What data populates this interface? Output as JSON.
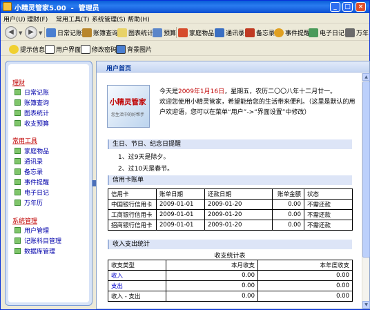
{
  "window": {
    "title": "小精灵管家5.00  -  管理员",
    "min_label": "_",
    "max_label": "□",
    "close_label": "×"
  },
  "menu": [
    "用户(U)",
    "理财(F)",
    "常用工具(T)",
    "系统管理(S)",
    "帮助(H)"
  ],
  "toolbar1": {
    "back_label": "◀",
    "forward_label": "▶",
    "items": [
      "日常记账",
      "账簿查询",
      "图表统计",
      "预算",
      "家庭物品",
      "通讯录",
      "备忘录",
      "事件提醒",
      "电子日记",
      "万年"
    ]
  },
  "toolbar2": {
    "items": [
      "提示信息",
      "用户界面",
      "修改密码",
      "背景图片"
    ]
  },
  "sidebar": {
    "groups": [
      {
        "title": "理财",
        "items": [
          "日常记账",
          "账簿查询",
          "图表统计",
          "收支预算"
        ]
      },
      {
        "title": "常用工具",
        "items": [
          "家庭物品",
          "通讯录",
          "备忘录",
          "事件提醒",
          "电子日记",
          "万年历"
        ]
      },
      {
        "title": "系统管理",
        "items": [
          "用户管理",
          "记账科目管理",
          "数据库管理"
        ]
      }
    ]
  },
  "main": {
    "header": "用户首页",
    "logo": {
      "title": "小精灵管家",
      "slogan": "您生活中的好帮手"
    },
    "welcome": {
      "prefix": "今天是",
      "date": "2009年1月16日",
      "suffix": "，星期五，农历二〇〇八年十二月廿一。",
      "line2": "欢迎您使用小精灵管家，希望能给您的生活带来便利。（这里是默认的用户欢迎语，您可以在菜单“用户”->“界面设置”中修改）"
    },
    "reminder": {
      "title": "生日、节日、纪念日提醒",
      "items": [
        "1、过9天是除夕。",
        "2、过10天是春节。"
      ]
    },
    "credit": {
      "title": "信用卡账单",
      "headers": [
        "信用卡",
        "账单日期",
        "还款日期",
        "账单金额",
        "状态"
      ],
      "rows": [
        [
          "中国银行信用卡",
          "2009-01-01",
          "2009-01-20",
          "0.00",
          "不需还款"
        ],
        [
          "工商银行信用卡",
          "2009-01-01",
          "2009-01-20",
          "0.00",
          "不需还款"
        ],
        [
          "招商银行信用卡",
          "2009-01-01",
          "2009-01-20",
          "0.00",
          "不需还款"
        ]
      ]
    },
    "stats": {
      "title": "收入支出统计",
      "caption": "收支统计表",
      "headers": [
        "收支类型",
        "本月收支",
        "本年度收支"
      ],
      "rows": [
        [
          "收入",
          "0.00",
          "0.00"
        ],
        [
          "支出",
          "0.00",
          "0.00"
        ],
        [
          "收入 - 支出",
          "0.00",
          "0.00"
        ]
      ]
    }
  },
  "colors": {
    "accent_red": "#c00000",
    "title_blue": "#0a5fd8",
    "sidebar_border": "#7a9bd6"
  }
}
